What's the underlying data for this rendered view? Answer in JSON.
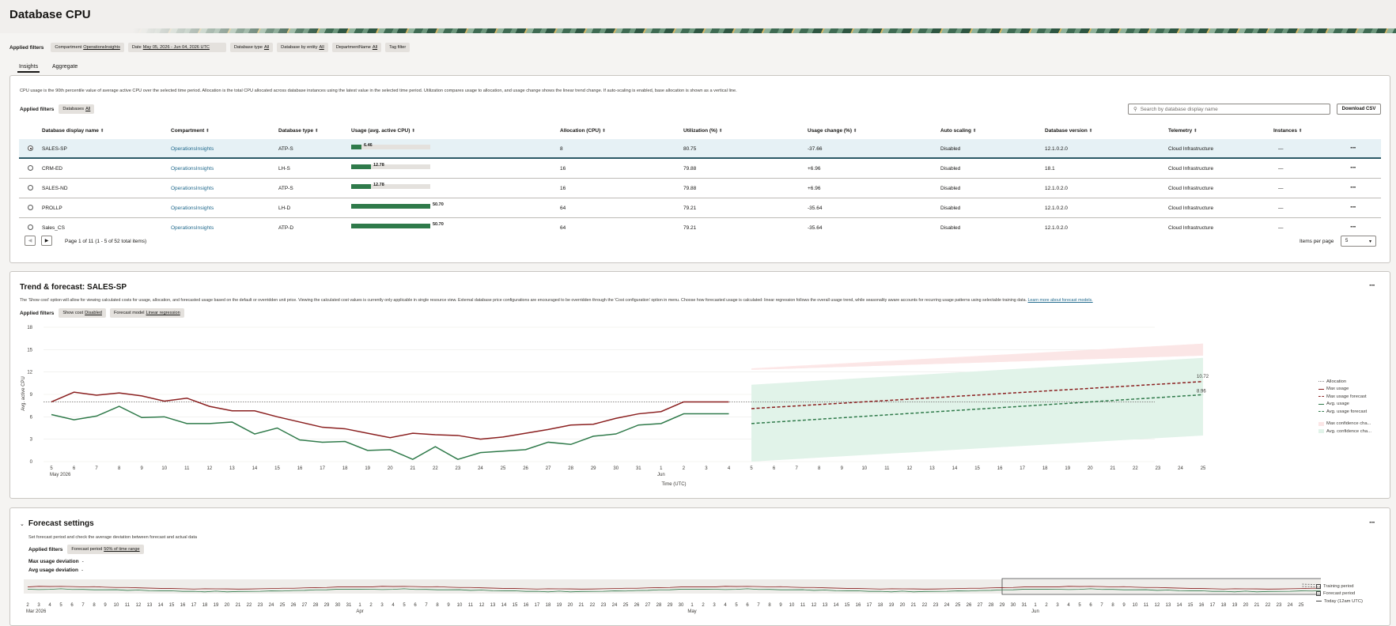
{
  "page": {
    "title": "Database CPU"
  },
  "applied_filters": {
    "label": "Applied filters",
    "items": [
      {
        "key": "Compartment",
        "value": "OperationsInsights"
      },
      {
        "key": "Date",
        "value": "May 05, 2026 - Jun 04, 2026 UTC"
      },
      {
        "key": "Database type",
        "value": "All"
      },
      {
        "key": "Database by entity",
        "value": "All"
      },
      {
        "key": "DepartmentName",
        "value": "All"
      },
      {
        "key": "Tag filter",
        "value": ""
      }
    ]
  },
  "tabs": [
    {
      "label": "Insights",
      "active": true
    },
    {
      "label": "Aggregate",
      "active": false
    }
  ],
  "insights": {
    "description": "CPU usage is the 90th percentile value of average active CPU over the selected time period. Allocation is the total CPU allocated across database instances using the latest value in the selected time period. Utilization compares usage to allocation, and usage change shows the linear trend change. If auto-scaling is enabled, base allocation is shown as a vertical line.",
    "filters_label": "Applied filters",
    "filter_chip": {
      "key": "Databases",
      "value": "All"
    },
    "search_placeholder": "Search by database display name",
    "download_label": "Download CSV",
    "columns": [
      "Database display name",
      "Compartment",
      "Database type",
      "Usage (avg. active CPU)",
      "Allocation (CPU)",
      "Utilization (%)",
      "Usage change (%)",
      "Auto scaling",
      "Database version",
      "Telemetry",
      "Instances"
    ],
    "rows": [
      {
        "name": "SALES-SP",
        "compartment": "OperationsInsights",
        "type": "ATP-S",
        "usage": "6.46",
        "usage_fraction": 0.13,
        "allocation": "8",
        "utilization": "80.75",
        "change": "-37.66",
        "autoscaling": "Disabled",
        "version": "12.1.0.2.0",
        "telemetry": "Cloud Infrastructure",
        "instances": "—",
        "selected": true
      },
      {
        "name": "CRM-ED",
        "compartment": "OperationsInsights",
        "type": "LH-S",
        "usage": "12.78",
        "usage_fraction": 0.25,
        "allocation": "16",
        "utilization": "79.88",
        "change": "+6.96",
        "autoscaling": "Disabled",
        "version": "18.1",
        "telemetry": "Cloud Infrastructure",
        "instances": "—",
        "selected": false
      },
      {
        "name": "SALES-ND",
        "compartment": "OperationsInsights",
        "type": "ATP-S",
        "usage": "12.78",
        "usage_fraction": 0.25,
        "allocation": "16",
        "utilization": "79.88",
        "change": "+6.96",
        "autoscaling": "Disabled",
        "version": "12.1.0.2.0",
        "telemetry": "Cloud Infrastructure",
        "instances": "—",
        "selected": false
      },
      {
        "name": "PROLLP",
        "compartment": "OperationsInsights",
        "type": "LH-D",
        "usage": "50.70",
        "usage_fraction": 1.0,
        "allocation": "64",
        "utilization": "79.21",
        "change": "-35.64",
        "autoscaling": "Disabled",
        "version": "12.1.0.2.0",
        "telemetry": "Cloud Infrastructure",
        "instances": "—",
        "selected": false
      },
      {
        "name": "Sales_CS",
        "compartment": "OperationsInsights",
        "type": "ATP-D",
        "usage": "50.70",
        "usage_fraction": 1.0,
        "allocation": "64",
        "utilization": "79.21",
        "change": "-35.64",
        "autoscaling": "Disabled",
        "version": "12.1.0.2.0",
        "telemetry": "Cloud Infrastructure",
        "instances": "—",
        "selected": false
      }
    ],
    "pagination": "Page 1 of 11 (1 - 5 of 52 total items)",
    "items_per_page_label": "Items per page",
    "items_per_page": "5"
  },
  "trend": {
    "title": "Trend & forecast: SALES-SP",
    "description": "The 'Show cost' option will allow for viewing calculated costs for usage, allocation, and forecasted usage based on the default or overridden unit price. Viewing the calculated cost values is currently only applicable in single resource view. External database price configurations are encouraged to be overridden through the 'Cost configuration' option in menu. Choose how forecasted usage is calculated: linear regression follows the overall usage trend, while seasonality aware accounts for recurring usage patterns using selectable training data.",
    "link": "Learn more about forecast models.",
    "filters_label": "Applied filters",
    "filters": [
      {
        "key": "Show cost",
        "value": "Disabled"
      },
      {
        "key": "Forecast model",
        "value": "Linear regression"
      }
    ],
    "legend": [
      "Allocation",
      "Max usage",
      "Max usage forecast",
      "Avg. usage",
      "Avg. usage forecast",
      "Max confidence cha...",
      "Avg. confidence cha..."
    ],
    "end_label_max": "10.72",
    "end_label_avg": "8.96"
  },
  "chart_data": {
    "type": "line",
    "ylabel": "Avg. active CPU",
    "xlabel": "Time (UTC)",
    "ylim": [
      0,
      18
    ],
    "yticks": [
      0,
      3,
      6,
      9,
      12,
      15,
      18
    ],
    "x": [
      "5",
      "6",
      "7",
      "8",
      "9",
      "10",
      "11",
      "12",
      "13",
      "14",
      "15",
      "16",
      "17",
      "18",
      "19",
      "20",
      "21",
      "22",
      "23",
      "24",
      "25",
      "26",
      "27",
      "28",
      "29",
      "30",
      "31",
      "1",
      "2",
      "3",
      "4",
      "5",
      "6",
      "7",
      "8",
      "9",
      "10",
      "11",
      "12",
      "13",
      "14",
      "15",
      "16",
      "17",
      "18",
      "19",
      "20",
      "21",
      "22",
      "23",
      "24",
      "25"
    ],
    "x_month_labels": [
      {
        "at": "5",
        "label": "May 2026"
      },
      {
        "at": "1",
        "label": "Jun"
      }
    ],
    "allocation": 8,
    "series": [
      {
        "name": "Max usage",
        "color": "#8a1f1f",
        "values": [
          8.0,
          9.3,
          8.9,
          9.2,
          8.8,
          8.1,
          8.5,
          7.4,
          6.8,
          6.8,
          6.0,
          5.3,
          4.6,
          4.4,
          3.8,
          3.2,
          3.8,
          3.6,
          3.5,
          3.0,
          3.3,
          3.8,
          4.3,
          4.9,
          5.0,
          5.8,
          6.4,
          6.7,
          8.0,
          8.0,
          8.0
        ]
      },
      {
        "name": "Avg. usage",
        "color": "#2f7a4a",
        "values": [
          6.3,
          5.6,
          6.1,
          7.4,
          5.9,
          6.0,
          5.1,
          5.1,
          5.3,
          3.7,
          4.5,
          2.9,
          2.6,
          2.7,
          1.5,
          1.6,
          0.3,
          2.0,
          0.3,
          1.2,
          1.4,
          1.6,
          2.6,
          2.3,
          3.4,
          3.7,
          4.9,
          5.1,
          6.4,
          6.4,
          6.4
        ]
      },
      {
        "name": "Max usage forecast",
        "color": "#8a1f1f",
        "start": 7.1,
        "end": 10.72
      },
      {
        "name": "Avg. usage forecast",
        "color": "#2f7a4a",
        "start": 5.1,
        "end": 8.96
      },
      {
        "name": "Max confidence channel",
        "color": "#fbe6e6",
        "low": [
          12.3,
          14.2
        ],
        "high": [
          12.5,
          15.8
        ]
      },
      {
        "name": "Avg. confidence channel",
        "color": "#e1f3e9",
        "low": [
          0,
          3.5
        ],
        "high": [
          10.3,
          13.9
        ]
      }
    ]
  },
  "forecast_settings": {
    "title": "Forecast settings",
    "description": "Set forecast period and check the average deviation between forecast and actual data",
    "filters_label": "Applied filters",
    "filter": {
      "key": "Forecast period",
      "value": "50% of time range"
    },
    "max_dev_label": "Max usage deviation",
    "max_dev_value": "-",
    "avg_dev_label": "Avg usage deviation",
    "avg_dev_value": "-",
    "legend": [
      "Training period",
      "Forecast period",
      "Today (12am UTC)"
    ],
    "timeline_ticks": [
      "2",
      "3",
      "4",
      "5",
      "6",
      "7",
      "8",
      "9",
      "10",
      "11",
      "12",
      "13",
      "14",
      "15",
      "16",
      "17",
      "18",
      "19",
      "20",
      "21",
      "22",
      "23",
      "24",
      "25",
      "26",
      "27",
      "28",
      "29",
      "30",
      "31",
      "1",
      "2",
      "3",
      "4",
      "5",
      "6",
      "7",
      "8",
      "9",
      "10",
      "11",
      "12",
      "13",
      "14",
      "15",
      "16",
      "17",
      "18",
      "19",
      "20",
      "21",
      "22",
      "23",
      "24",
      "25",
      "26",
      "27",
      "28",
      "29",
      "30",
      "1",
      "2",
      "3",
      "4",
      "5",
      "6",
      "7",
      "8",
      "9",
      "10",
      "11",
      "12",
      "13",
      "14",
      "15",
      "16",
      "17",
      "18",
      "19",
      "20",
      "21",
      "22",
      "23",
      "24",
      "25",
      "26",
      "27",
      "28",
      "29",
      "30",
      "31",
      "1",
      "2",
      "3",
      "4",
      "5",
      "6",
      "7",
      "8",
      "9",
      "10",
      "11",
      "12",
      "13",
      "14",
      "15",
      "16",
      "17",
      "18",
      "19",
      "20",
      "21",
      "22",
      "23",
      "24",
      "25"
    ],
    "timeline_months": [
      {
        "index": 0,
        "label": "Mar 2026"
      },
      {
        "index": 30,
        "label": "Apr"
      },
      {
        "index": 60,
        "label": "May"
      },
      {
        "index": 91,
        "label": "Jun"
      }
    ]
  }
}
